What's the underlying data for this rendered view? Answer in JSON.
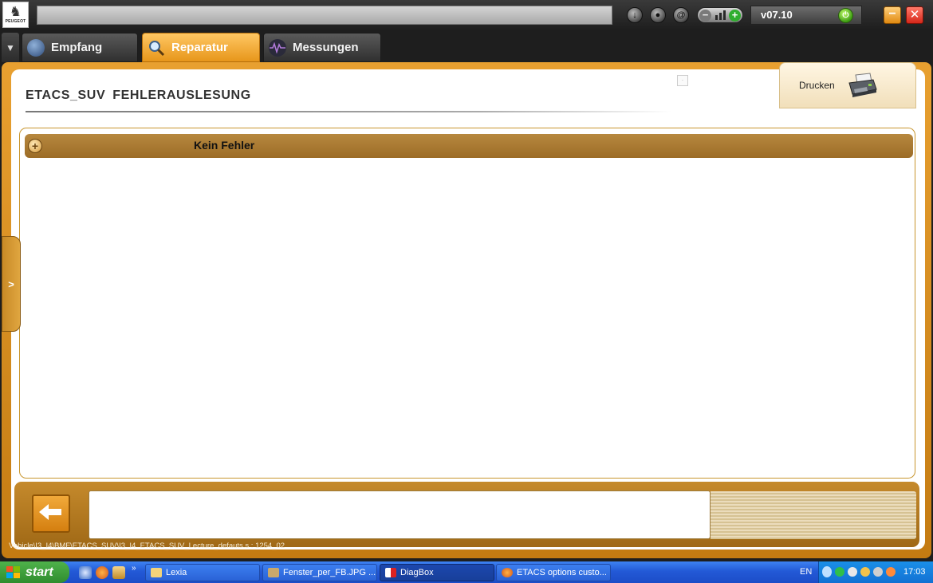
{
  "app": {
    "brand": "PEUGEOT",
    "version": "v07.10"
  },
  "tabs": [
    {
      "label": "Empfang",
      "active": false
    },
    {
      "label": "Reparatur",
      "active": true
    },
    {
      "label": "Messungen",
      "active": false
    }
  ],
  "page": {
    "title": "ETACS_SUV  FEHLERAUSLESUNG",
    "print_label": "Drucken"
  },
  "results": {
    "rows": [
      {
        "text": "Kein Fehler"
      }
    ]
  },
  "footer": {
    "path": "Vehicle\\I3_I4\\BMF\\ETACS_SUV\\I3_I4_ETACS_SUV_Lecture_defauts.s : 1254_02",
    "message": ""
  },
  "taskbar": {
    "start_label": "start",
    "windows": [
      {
        "label": "Lexia",
        "active": false,
        "icon": "folder-icon"
      },
      {
        "label": "Fenster_per_FB.JPG ...",
        "active": false,
        "icon": "image-viewer-icon"
      },
      {
        "label": "DiagBox",
        "active": true,
        "icon": "diagbox-icon"
      },
      {
        "label": "ETACS options custo...",
        "active": false,
        "icon": "firefox-icon"
      }
    ],
    "language": "EN",
    "clock": "17:03"
  },
  "colors": {
    "accent": "#e29a2a",
    "row_bg": "#a97730",
    "taskbar": "#245edb",
    "start": "#3c9e3a"
  }
}
